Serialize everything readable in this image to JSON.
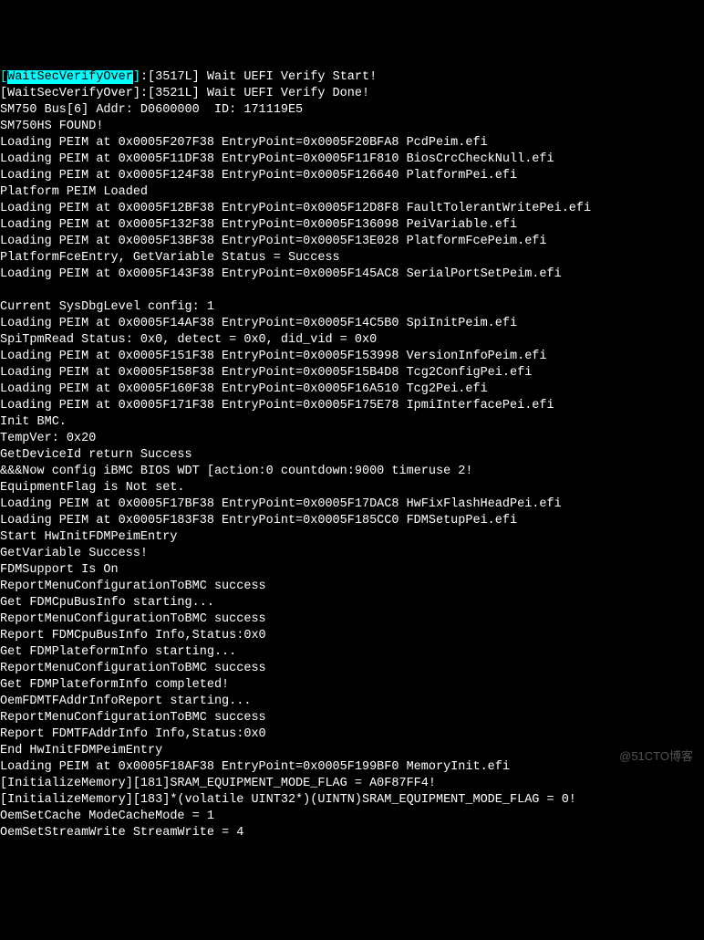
{
  "watermark": "@51CTO博客",
  "lines": [
    {
      "segments": [
        {
          "t": "[",
          "c": "cyan"
        },
        {
          "t": "WaitSecVerifyOver",
          "c": "hl"
        },
        {
          "t": "]",
          "c": "cyan"
        },
        {
          "t": ":[3517L] Wait UEFI Verify Start!"
        }
      ]
    },
    {
      "segments": [
        {
          "t": "[WaitSecVerifyOver]:[3521L] Wait UEFI Verify Done!"
        }
      ]
    },
    {
      "segments": [
        {
          "t": "SM750 Bus[6] Addr: D0600000  ID: 171119E5"
        }
      ]
    },
    {
      "segments": [
        {
          "t": "SM750HS FOUND!"
        }
      ]
    },
    {
      "segments": [
        {
          "t": "Loading PEIM at 0x0005F207F38 EntryPoint=0x0005F20BFA8 PcdPeim.efi"
        }
      ]
    },
    {
      "segments": [
        {
          "t": "Loading PEIM at 0x0005F11DF38 EntryPoint=0x0005F11F810 BiosCrcCheckNull.efi"
        }
      ]
    },
    {
      "segments": [
        {
          "t": "Loading PEIM at 0x0005F124F38 EntryPoint=0x0005F126640 PlatformPei.efi"
        }
      ]
    },
    {
      "segments": [
        {
          "t": "Platform PEIM Loaded"
        }
      ]
    },
    {
      "segments": [
        {
          "t": "Loading PEIM at 0x0005F12BF38 EntryPoint=0x0005F12D8F8 FaultTolerantWritePei.efi"
        }
      ]
    },
    {
      "segments": [
        {
          "t": "Loading PEIM at 0x0005F132F38 EntryPoint=0x0005F136098 PeiVariable.efi"
        }
      ]
    },
    {
      "segments": [
        {
          "t": "Loading PEIM at 0x0005F13BF38 EntryPoint=0x0005F13E028 PlatformFcePeim.efi"
        }
      ]
    },
    {
      "segments": [
        {
          "t": "PlatformFceEntry, GetVariable Status = Success"
        }
      ]
    },
    {
      "segments": [
        {
          "t": "Loading PEIM at 0x0005F143F38 EntryPoint=0x0005F145AC8 SerialPortSetPeim.efi"
        }
      ]
    },
    {
      "segments": [
        {
          "t": ""
        }
      ]
    },
    {
      "segments": [
        {
          "t": "Current SysDbgLevel config: 1"
        }
      ]
    },
    {
      "segments": [
        {
          "t": "Loading PEIM at 0x0005F14AF38 EntryPoint=0x0005F14C5B0 SpiInitPeim.efi"
        }
      ]
    },
    {
      "segments": [
        {
          "t": "SpiTpmRead Status: 0x0, detect = 0x0, did_vid = 0x0"
        }
      ]
    },
    {
      "segments": [
        {
          "t": "Loading PEIM at 0x0005F151F38 EntryPoint=0x0005F153998 VersionInfoPeim.efi"
        }
      ]
    },
    {
      "segments": [
        {
          "t": "Loading PEIM at 0x0005F158F38 EntryPoint=0x0005F15B4D8 Tcg2ConfigPei.efi"
        }
      ]
    },
    {
      "segments": [
        {
          "t": "Loading PEIM at 0x0005F160F38 EntryPoint=0x0005F16A510 Tcg2Pei.efi"
        }
      ]
    },
    {
      "segments": [
        {
          "t": "Loading PEIM at 0x0005F171F38 EntryPoint=0x0005F175E78 IpmiInterfacePei.efi"
        }
      ]
    },
    {
      "segments": [
        {
          "t": "Init BMC."
        }
      ]
    },
    {
      "segments": [
        {
          "t": "TempVer: 0x20"
        }
      ]
    },
    {
      "segments": [
        {
          "t": "GetDeviceId return Success"
        }
      ]
    },
    {
      "segments": [
        {
          "t": "&&&Now config iBMC BIOS WDT [action:0 countdown:9000 timeruse 2!"
        }
      ]
    },
    {
      "segments": [
        {
          "t": "EquipmentFlag is Not set."
        }
      ]
    },
    {
      "segments": [
        {
          "t": "Loading PEIM at 0x0005F17BF38 EntryPoint=0x0005F17DAC8 HwFixFlashHeadPei.efi"
        }
      ]
    },
    {
      "segments": [
        {
          "t": "Loading PEIM at 0x0005F183F38 EntryPoint=0x0005F185CC0 FDMSetupPei.efi"
        }
      ]
    },
    {
      "segments": [
        {
          "t": "Start HwInitFDMPeimEntry"
        }
      ]
    },
    {
      "segments": [
        {
          "t": "GetVariable Success!"
        }
      ]
    },
    {
      "segments": [
        {
          "t": "FDMSupport Is On"
        }
      ]
    },
    {
      "segments": [
        {
          "t": "ReportMenuConfigurationToBMC success"
        }
      ]
    },
    {
      "segments": [
        {
          "t": "Get FDMCpuBusInfo starting..."
        }
      ]
    },
    {
      "segments": [
        {
          "t": "ReportMenuConfigurationToBMC success"
        }
      ]
    },
    {
      "segments": [
        {
          "t": "Report FDMCpuBusInfo Info,Status:0x0"
        }
      ]
    },
    {
      "segments": [
        {
          "t": "Get FDMPlateformInfo starting..."
        }
      ]
    },
    {
      "segments": [
        {
          "t": "ReportMenuConfigurationToBMC success"
        }
      ]
    },
    {
      "segments": [
        {
          "t": "Get FDMPlateformInfo completed!"
        }
      ]
    },
    {
      "segments": [
        {
          "t": "OemFDMTFAddrInfoReport starting..."
        }
      ]
    },
    {
      "segments": [
        {
          "t": "ReportMenuConfigurationToBMC success"
        }
      ]
    },
    {
      "segments": [
        {
          "t": "Report FDMTFAddrInfo Info,Status:0x0"
        }
      ]
    },
    {
      "segments": [
        {
          "t": "End HwInitFDMPeimEntry"
        }
      ]
    },
    {
      "segments": [
        {
          "t": "Loading PEIM at 0x0005F18AF38 EntryPoint=0x0005F199BF0 MemoryInit.efi"
        }
      ]
    },
    {
      "segments": [
        {
          "t": "[InitializeMemory][181]SRAM_EQUIPMENT_MODE_FLAG = A0F87FF4!"
        }
      ]
    },
    {
      "segments": [
        {
          "t": "[InitializeMemory][183]*(volatile UINT32*)(UINTN)SRAM_EQUIPMENT_MODE_FLAG = 0!"
        }
      ]
    },
    {
      "segments": [
        {
          "t": "OemSetCache ModeCacheMode = 1"
        }
      ]
    },
    {
      "segments": [
        {
          "t": "OemSetStreamWrite StreamWrite = 4"
        }
      ]
    }
  ]
}
